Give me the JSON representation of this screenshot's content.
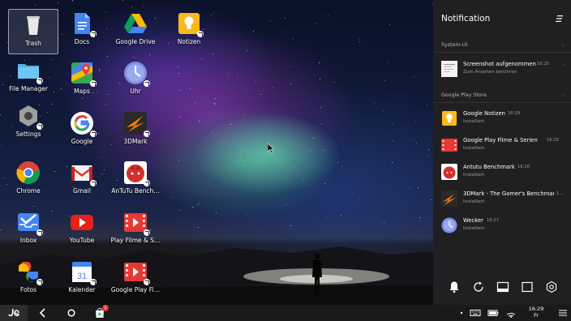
{
  "desktop": {
    "icons": [
      {
        "label": "Trash",
        "icon": "trash-icon"
      },
      {
        "label": "Docs",
        "icon": "docs-icon"
      },
      {
        "label": "Google Drive",
        "icon": "google-drive-icon"
      },
      {
        "label": "Notizen",
        "icon": "google-keep-icon"
      },
      {
        "label": "File Manager",
        "icon": "folder-icon"
      },
      {
        "label": "Maps",
        "icon": "maps-icon"
      },
      {
        "label": "Uhr",
        "icon": "clock-icon"
      },
      {
        "label": "Settings",
        "icon": "settings-icon"
      },
      {
        "label": "Google",
        "icon": "google-icon"
      },
      {
        "label": "3DMark",
        "icon": "3dmark-icon"
      },
      {
        "label": "Chrome",
        "icon": "chrome-icon"
      },
      {
        "label": "Gmail",
        "icon": "gmail-icon"
      },
      {
        "label": "AnTuTu Bench…",
        "icon": "antutu-icon"
      },
      {
        "label": "Inbox",
        "icon": "inbox-icon"
      },
      {
        "label": "YouTube",
        "icon": "youtube-icon"
      },
      {
        "label": "Play Filme & S…",
        "icon": "play-movies-icon"
      },
      {
        "label": "Fotos",
        "icon": "photos-icon"
      },
      {
        "label": "Kalender",
        "icon": "calendar-icon"
      },
      {
        "label": "Google Play Fi…",
        "icon": "play-movies-icon"
      }
    ],
    "calendar_day": "31"
  },
  "notification_panel": {
    "title": "Notification",
    "sections": [
      {
        "title": "System-UI",
        "items": [
          {
            "title": "Screenshot aufgenommen",
            "time": "16:25",
            "subtitle": "Zum Ansehen berühren",
            "icon": "screenshot-icon"
          }
        ]
      },
      {
        "title": "Google Play Store",
        "items": [
          {
            "title": "Google Notizen",
            "time": "16:29",
            "subtitle": "Installiert",
            "icon": "google-keep-icon"
          },
          {
            "title": "Google Play Filme & Serien",
            "time": "16:29",
            "subtitle": "Installiert",
            "icon": "play-movies-icon"
          },
          {
            "title": "Antutu Benchmark",
            "time": "16:28",
            "subtitle": "Installiert",
            "icon": "antutu-icon"
          },
          {
            "title": "3DMark - The Gamer's Benchmark",
            "time": "1…",
            "subtitle": "Installiert",
            "icon": "3dmark-icon"
          },
          {
            "title": "Wecker",
            "time": "16:27",
            "subtitle": "Installiert",
            "icon": "clock-icon"
          }
        ]
      }
    ],
    "actions": [
      "notifications-icon",
      "rotate-icon",
      "screenshot-icon",
      "fullscreen-icon",
      "settings-icon"
    ]
  },
  "taskbar": {
    "start_icon": "jide-logo-icon",
    "nav": [
      "back-icon",
      "home-icon"
    ],
    "pinned_app": "play-store-icon",
    "pinned_badge": "1",
    "tray": [
      "dot-icon",
      "keyboard-icon",
      "battery-icon",
      "wifi-icon"
    ],
    "clock_time": "16:29",
    "clock_day": "Fr",
    "menu_icon": "notification-menu-icon"
  },
  "colors": {
    "panel_bg": "#202022",
    "taskbar_bg": "#1a1a1a",
    "badge": "#e53935"
  }
}
